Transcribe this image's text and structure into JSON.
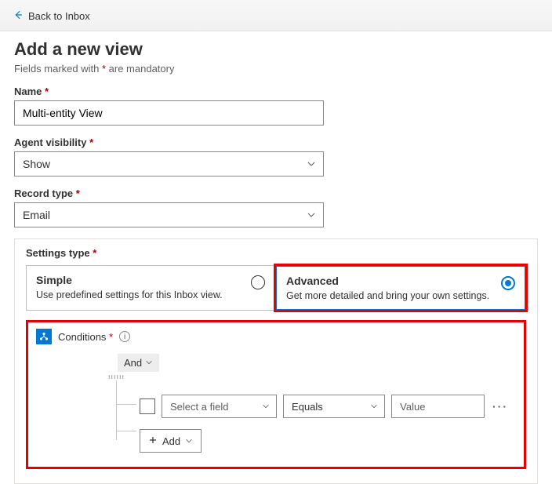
{
  "back_link": "Back to Inbox",
  "title": "Add a new view",
  "mandatory_note_prefix": "Fields marked with ",
  "mandatory_note_suffix": " are mandatory",
  "asterisk": "*",
  "fields": {
    "name": {
      "label": "Name",
      "value": "Multi-entity View"
    },
    "agent_visibility": {
      "label": "Agent visibility",
      "value": "Show"
    },
    "record_type": {
      "label": "Record type",
      "value": "Email"
    }
  },
  "settings_type": {
    "label": "Settings type",
    "simple": {
      "title": "Simple",
      "desc": "Use predefined settings for this Inbox view."
    },
    "advanced": {
      "title": "Advanced",
      "desc": "Get more detailed and bring your own settings."
    },
    "selected": "advanced"
  },
  "conditions": {
    "label": "Conditions",
    "and_chip": "And",
    "field_placeholder": "Select a field",
    "operator_value": "Equals",
    "value_placeholder": "Value",
    "add_label": "Add"
  }
}
